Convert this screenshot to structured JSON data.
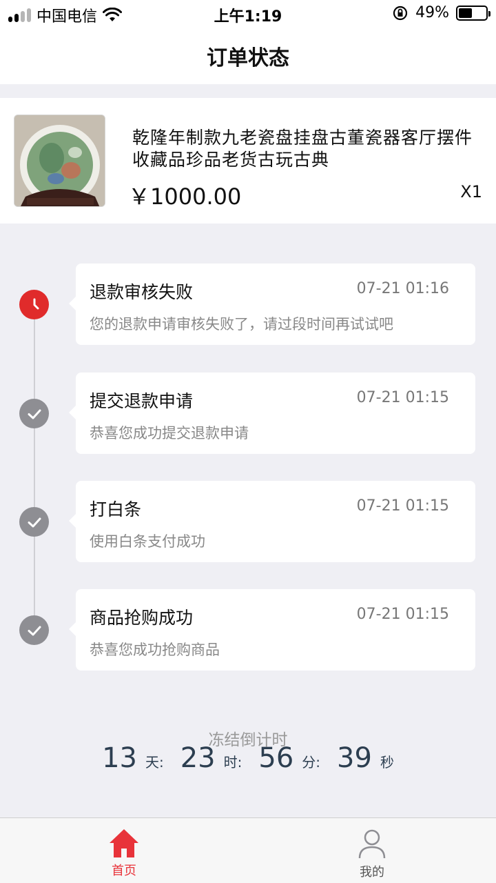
{
  "status_bar": {
    "carrier": "中国电信",
    "time": "上午1:19",
    "battery": "49%",
    "battery_level": 0.49
  },
  "nav": {
    "title": "订单状态"
  },
  "product": {
    "title": "乾隆年制款九老瓷盘挂盘古董瓷器客厅摆件收藏品珍品老货古玩古典",
    "price": "￥1000.00",
    "quantity": "X1"
  },
  "timeline": [
    {
      "title": "退款审核失败",
      "time": "07-21 01:16",
      "desc": "您的退款申请审核失败了，请过段时间再试试吧",
      "status": "current",
      "icon": "clock-icon"
    },
    {
      "title": "提交退款申请",
      "time": "07-21 01:15",
      "desc": "恭喜您成功提交退款申请",
      "status": "done",
      "icon": "check-icon"
    },
    {
      "title": "打白条",
      "time": "07-21 01:15",
      "desc": "使用白条支付成功",
      "status": "done",
      "icon": "check-icon"
    },
    {
      "title": "商品抢购成功",
      "time": "07-21 01:15",
      "desc": "恭喜您成功抢购商品",
      "status": "done",
      "icon": "check-icon"
    }
  ],
  "countdown": {
    "label": "冻结倒计时",
    "days": "13",
    "days_unit": "天:",
    "hours": "23",
    "hours_unit": "时:",
    "minutes": "56",
    "minutes_unit": "分:",
    "seconds": "39",
    "seconds_unit": "秒"
  },
  "tabs": [
    {
      "label": "首页",
      "icon": "home-icon",
      "active": true
    },
    {
      "label": "我的",
      "icon": "user-icon",
      "active": false
    }
  ],
  "colors": {
    "accent": "#e8333a",
    "alert": "#e02b2b",
    "done": "#8e8e93",
    "countdown": "#2c3e50"
  }
}
